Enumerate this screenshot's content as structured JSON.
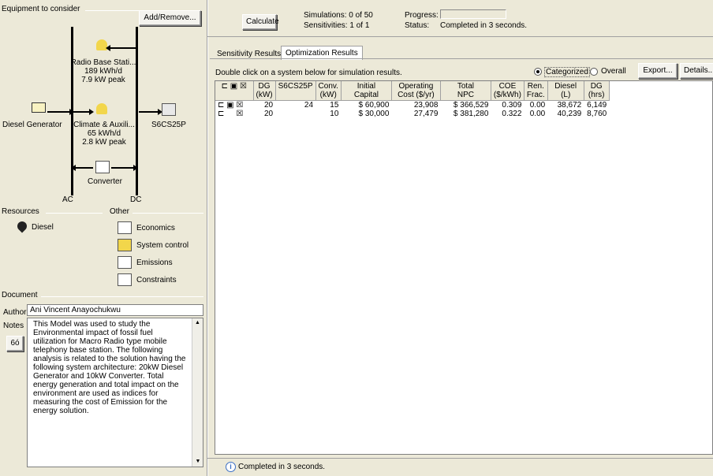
{
  "left": {
    "equipment_label": "Equipment to consider",
    "add_remove": "Add/Remove...",
    "radio_base": {
      "name": "Radio Base Stati...",
      "energy": "189 kWh/d",
      "peak": "7.9 kW peak"
    },
    "diesel_generator": "Diesel Generator",
    "climate": {
      "name": "Climate & Auxili...",
      "energy": "65 kWh/d",
      "peak": "2.8 kW peak"
    },
    "battery": "S6CS25P",
    "converter": "Converter",
    "ac": "AC",
    "dc": "DC",
    "resources_label": "Resources",
    "other_label": "Other",
    "resources": [
      "Diesel"
    ],
    "other": [
      "Economics",
      "System control",
      "Emissions",
      "Constraints"
    ],
    "document_label": "Document",
    "author_label": "Author",
    "author_value": "Ani Vincent Anayochukwu",
    "notes_label": "Notes",
    "notes": "This Model was used to study the Environmental impact of fossil fuel utilization for Macro Radio type mobile telephony base station. The following analysis is related to the solution having the following system architecture: 20kW Diesel Generator and 10kW Converter. Total energy generation and total impact on the environment are used as indices for measuring the cost of Emission for the energy solution."
  },
  "top": {
    "calculate": "Calculate",
    "simulations": "Simulations:  0 of 50",
    "sensitivities": "Sensitivities:  1 of 1",
    "progress_label": "Progress:",
    "status_label": "Status:",
    "status_value": "Completed in 3 seconds."
  },
  "tabs": [
    "Sensitivity Results",
    "Optimization Results"
  ],
  "instructions": "Double click on a system below for simulation results.",
  "view": {
    "categorized": "Categorized",
    "overall": "Overall",
    "export": "Export...",
    "details": "Details..."
  },
  "table": {
    "headers": [
      "DG\n(kW)",
      "S6CS25P",
      "Conv.\n(kW)",
      "Initial\nCapital",
      "Operating\nCost ($/yr)",
      "Total\nNPC",
      "COE\n($/kWh)",
      "Ren.\nFrac.",
      "Diesel\n(L)",
      "DG\n(hrs)"
    ],
    "rows": [
      [
        "20",
        "24",
        "15",
        "$ 60,900",
        "23,908",
        "$ 366,529",
        "0.309",
        "0.00",
        "38,672",
        "6,149"
      ],
      [
        "20",
        "",
        "10",
        "$ 30,000",
        "27,479",
        "$ 381,280",
        "0.322",
        "0.00",
        "40,239",
        "8,760"
      ]
    ]
  },
  "statusbar": "Completed in 3 seconds."
}
